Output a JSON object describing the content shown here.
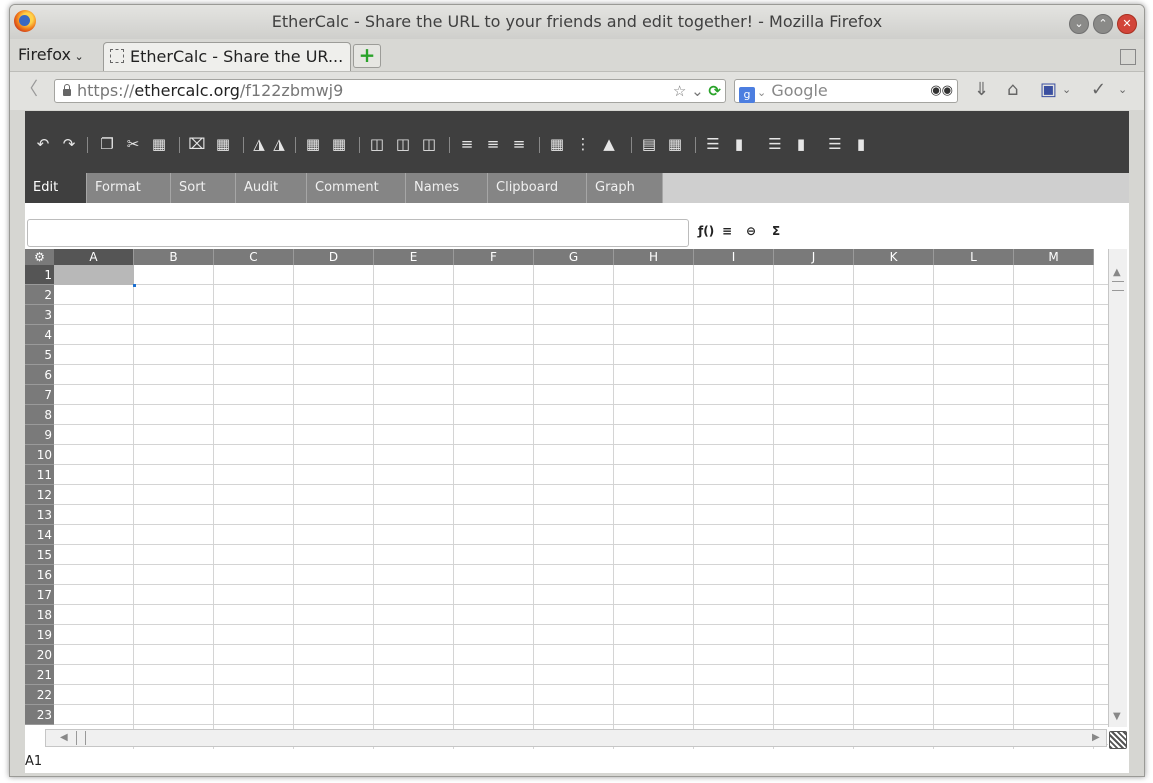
{
  "window": {
    "title": "EtherCalc - Share the URL to your friends and edit together! - Mozilla Firefox"
  },
  "browser": {
    "menu_label": "Firefox",
    "tab_label": "EtherCalc - Share the UR...",
    "url_scheme": "https://",
    "url_host": "ethercalc.org",
    "url_path": "/f122zbmwj9",
    "search_placeholder": "Google"
  },
  "app": {
    "tabs": [
      "Edit",
      "Format",
      "Sort",
      "Audit",
      "Comment",
      "Names",
      "Clipboard",
      "Graph"
    ],
    "active_tab": "Edit",
    "formula_value": "",
    "formula_buttons": [
      "ƒ()",
      "≡",
      "⊖",
      "Σ"
    ],
    "corner_icon": "gear-icon",
    "columns": [
      "A",
      "B",
      "C",
      "D",
      "E",
      "F",
      "G",
      "H",
      "I",
      "J",
      "K",
      "L",
      "M"
    ],
    "rows": [
      "1",
      "2",
      "3",
      "4",
      "5",
      "6",
      "7",
      "8",
      "9",
      "10",
      "11",
      "12",
      "13",
      "14",
      "15",
      "16",
      "17",
      "18",
      "19",
      "20",
      "21",
      "22",
      "23"
    ],
    "selected_cell": "A1",
    "status_text": "A1",
    "toolbar_icons": [
      "undo-icon",
      "redo-icon",
      "copy-icon",
      "cut-icon",
      "paste-icon",
      "delete-icon",
      "paste-formats-icon",
      "lock-icon",
      "unlock-icon",
      "insert-row-icon",
      "insert-col-icon",
      "move-paste-icon",
      "move-insert-icon",
      "move-insert-alt-icon",
      "align-left-icon",
      "align-center-icon",
      "align-right-icon",
      "borders-icon",
      "no-borders-icon",
      "fill-icon",
      "merge-icon",
      "unmerge-icon",
      "insert-row-after-icon",
      "insert-col-after-icon",
      "delete-row-icon",
      "delete-col-icon",
      "hide-row-icon",
      "hide-col-icon"
    ]
  }
}
